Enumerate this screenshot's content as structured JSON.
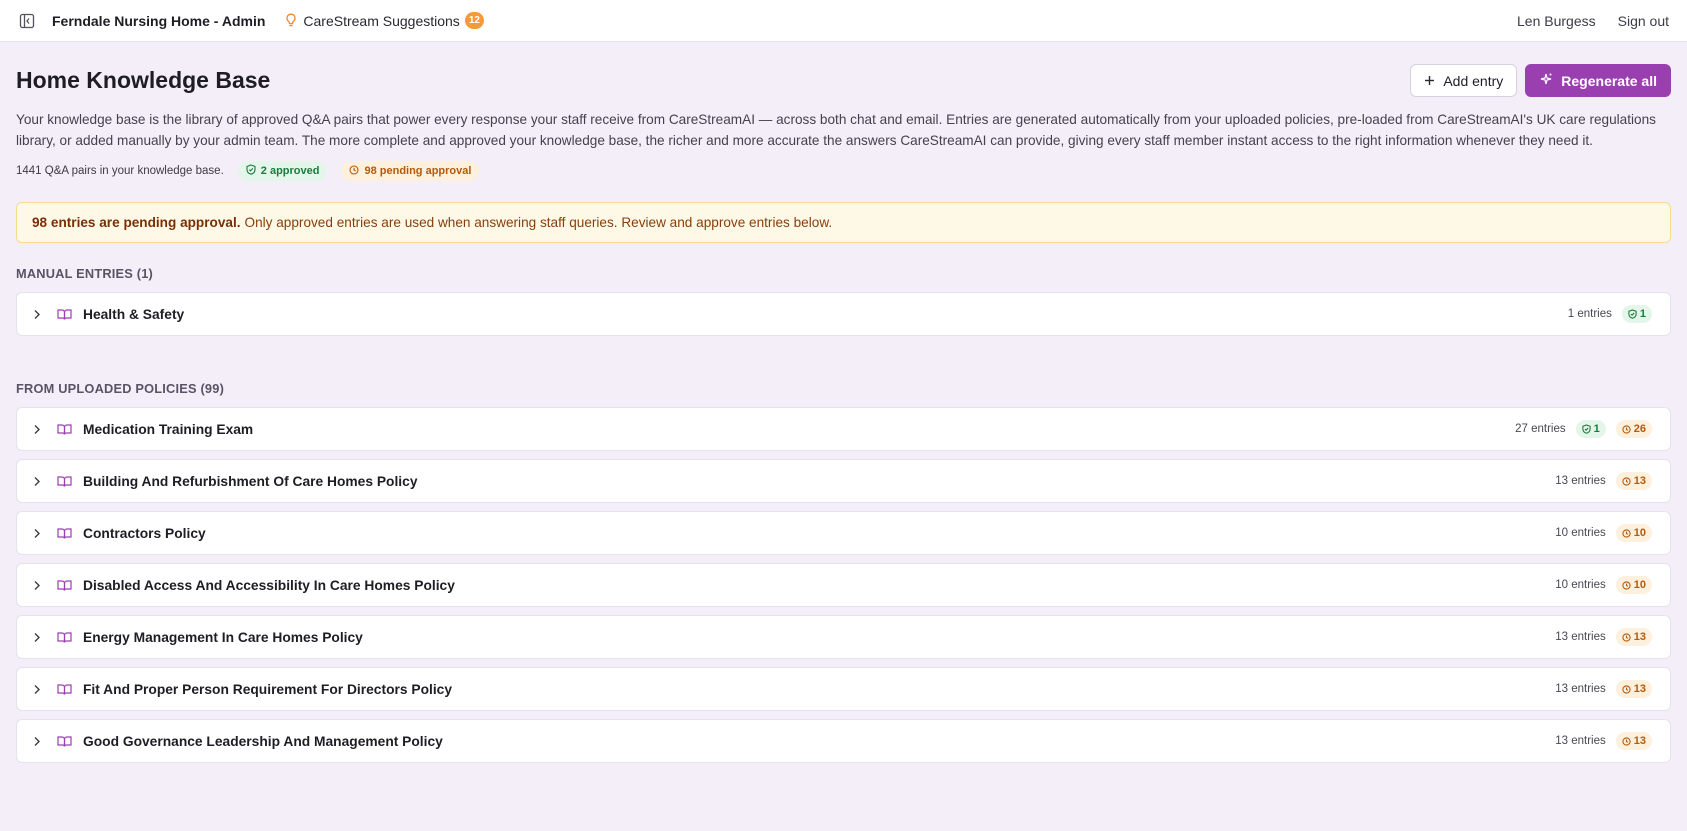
{
  "topbar": {
    "app_title": "Ferndale Nursing Home - Admin",
    "suggestions_label": "CareStream Suggestions",
    "suggestions_count": "12",
    "user_name": "Len Burgess",
    "sign_out": "Sign out"
  },
  "header": {
    "title": "Home Knowledge Base",
    "add_entry": "Add entry",
    "regenerate_all": "Regenerate all"
  },
  "intro": "Your knowledge base is the library of approved Q&A pairs that power every response your staff receive from CareStreamAI — across both chat and email. Entries are generated automatically from your uploaded policies, pre-loaded from CareStreamAI's UK care regulations library, or added manually by your admin team. The more complete and approved your knowledge base, the richer and more accurate the answers CareStreamAI can provide, giving every staff member instant access to the right information whenever they need it.",
  "stats": {
    "total": "1441 Q&A pairs in your knowledge base.",
    "approved": "2 approved",
    "pending": "98 pending approval"
  },
  "alert": {
    "bold": "98 entries are pending approval.",
    "text": "Only approved entries are used when answering staff queries. Review and approve entries below."
  },
  "manual": {
    "title": "MANUAL ENTRIES (1)",
    "groups": [
      {
        "name": "Health & Safety",
        "entries": "1 entries",
        "approved": "1",
        "pending": ""
      }
    ]
  },
  "uploaded": {
    "title": "FROM UPLOADED POLICIES (99)",
    "groups": [
      {
        "name": "Medication Training Exam",
        "entries": "27 entries",
        "approved": "1",
        "pending": "26"
      },
      {
        "name": "Building And Refurbishment Of Care Homes Policy",
        "entries": "13 entries",
        "approved": "",
        "pending": "13"
      },
      {
        "name": "Contractors Policy",
        "entries": "10 entries",
        "approved": "",
        "pending": "10"
      },
      {
        "name": "Disabled Access And Accessibility In Care Homes Policy",
        "entries": "10 entries",
        "approved": "",
        "pending": "10"
      },
      {
        "name": "Energy Management In Care Homes Policy",
        "entries": "13 entries",
        "approved": "",
        "pending": "13"
      },
      {
        "name": "Fit And Proper Person Requirement For Directors Policy",
        "entries": "13 entries",
        "approved": "",
        "pending": "13"
      },
      {
        "name": "Good Governance Leadership And Management Policy",
        "entries": "13 entries",
        "approved": "",
        "pending": "13"
      }
    ]
  },
  "colors": {
    "accent": "#9a3fb0",
    "background": "#f3eef8",
    "approved": "#1c7a3e",
    "pending": "#b45a0c",
    "badge": "#f59a3a"
  }
}
